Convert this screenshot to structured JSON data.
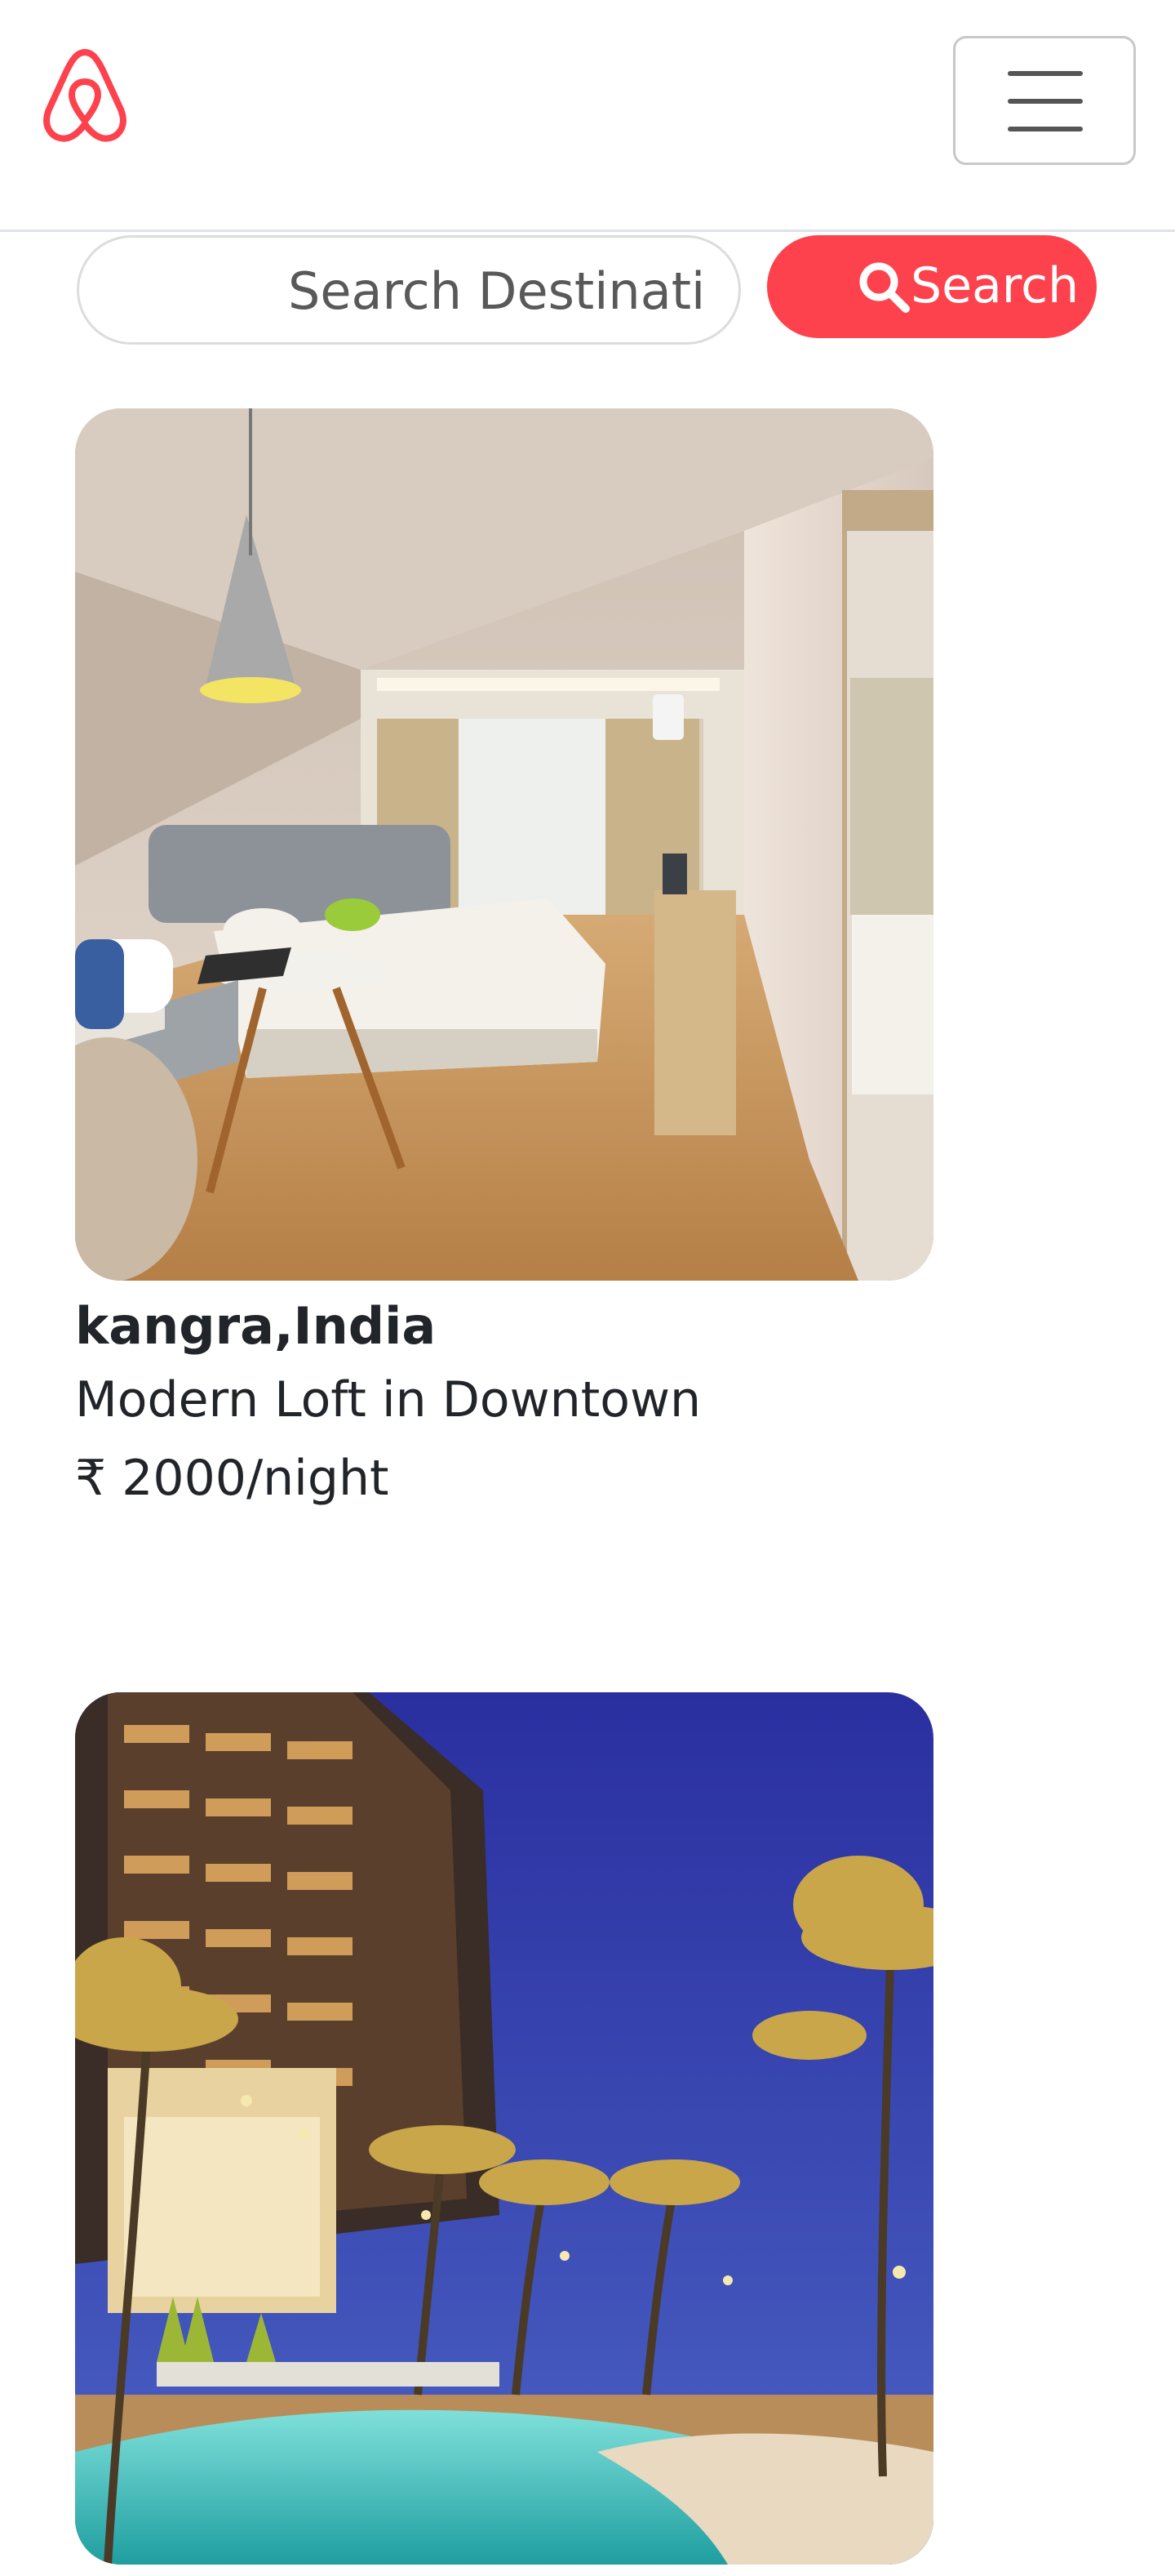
{
  "navbar": {
    "brand_icon": "airbnb-logo",
    "brand_color": "#fe424d",
    "menu_icon": "hamburger-icon"
  },
  "search": {
    "placeholder": "Search Destinations",
    "button_label": "Search",
    "button_icon": "search-icon",
    "button_color": "#fe424d"
  },
  "listings": [
    {
      "location": "kangra,India",
      "title": "Modern Loft in Downtown",
      "price": "₹ 2000/night",
      "image": "hotel-room-photo"
    },
    {
      "location": "",
      "title": "",
      "price": "",
      "image": "resort-pool-night-photo"
    }
  ]
}
